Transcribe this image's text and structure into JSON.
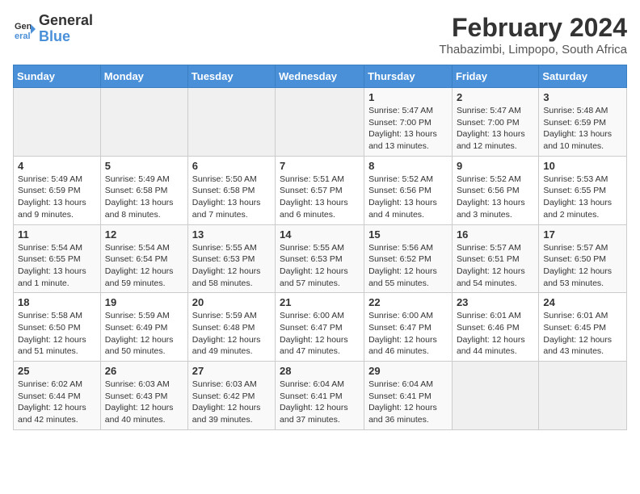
{
  "logo": {
    "text_general": "General",
    "text_blue": "Blue"
  },
  "title": "February 2024",
  "subtitle": "Thabazimbi, Limpopo, South Africa",
  "days_of_week": [
    "Sunday",
    "Monday",
    "Tuesday",
    "Wednesday",
    "Thursday",
    "Friday",
    "Saturday"
  ],
  "weeks": [
    [
      {
        "day": "",
        "info": ""
      },
      {
        "day": "",
        "info": ""
      },
      {
        "day": "",
        "info": ""
      },
      {
        "day": "",
        "info": ""
      },
      {
        "day": "1",
        "info": "Sunrise: 5:47 AM\nSunset: 7:00 PM\nDaylight: 13 hours and 13 minutes."
      },
      {
        "day": "2",
        "info": "Sunrise: 5:47 AM\nSunset: 7:00 PM\nDaylight: 13 hours and 12 minutes."
      },
      {
        "day": "3",
        "info": "Sunrise: 5:48 AM\nSunset: 6:59 PM\nDaylight: 13 hours and 10 minutes."
      }
    ],
    [
      {
        "day": "4",
        "info": "Sunrise: 5:49 AM\nSunset: 6:59 PM\nDaylight: 13 hours and 9 minutes."
      },
      {
        "day": "5",
        "info": "Sunrise: 5:49 AM\nSunset: 6:58 PM\nDaylight: 13 hours and 8 minutes."
      },
      {
        "day": "6",
        "info": "Sunrise: 5:50 AM\nSunset: 6:58 PM\nDaylight: 13 hours and 7 minutes."
      },
      {
        "day": "7",
        "info": "Sunrise: 5:51 AM\nSunset: 6:57 PM\nDaylight: 13 hours and 6 minutes."
      },
      {
        "day": "8",
        "info": "Sunrise: 5:52 AM\nSunset: 6:56 PM\nDaylight: 13 hours and 4 minutes."
      },
      {
        "day": "9",
        "info": "Sunrise: 5:52 AM\nSunset: 6:56 PM\nDaylight: 13 hours and 3 minutes."
      },
      {
        "day": "10",
        "info": "Sunrise: 5:53 AM\nSunset: 6:55 PM\nDaylight: 13 hours and 2 minutes."
      }
    ],
    [
      {
        "day": "11",
        "info": "Sunrise: 5:54 AM\nSunset: 6:55 PM\nDaylight: 13 hours and 1 minute."
      },
      {
        "day": "12",
        "info": "Sunrise: 5:54 AM\nSunset: 6:54 PM\nDaylight: 12 hours and 59 minutes."
      },
      {
        "day": "13",
        "info": "Sunrise: 5:55 AM\nSunset: 6:53 PM\nDaylight: 12 hours and 58 minutes."
      },
      {
        "day": "14",
        "info": "Sunrise: 5:55 AM\nSunset: 6:53 PM\nDaylight: 12 hours and 57 minutes."
      },
      {
        "day": "15",
        "info": "Sunrise: 5:56 AM\nSunset: 6:52 PM\nDaylight: 12 hours and 55 minutes."
      },
      {
        "day": "16",
        "info": "Sunrise: 5:57 AM\nSunset: 6:51 PM\nDaylight: 12 hours and 54 minutes."
      },
      {
        "day": "17",
        "info": "Sunrise: 5:57 AM\nSunset: 6:50 PM\nDaylight: 12 hours and 53 minutes."
      }
    ],
    [
      {
        "day": "18",
        "info": "Sunrise: 5:58 AM\nSunset: 6:50 PM\nDaylight: 12 hours and 51 minutes."
      },
      {
        "day": "19",
        "info": "Sunrise: 5:59 AM\nSunset: 6:49 PM\nDaylight: 12 hours and 50 minutes."
      },
      {
        "day": "20",
        "info": "Sunrise: 5:59 AM\nSunset: 6:48 PM\nDaylight: 12 hours and 49 minutes."
      },
      {
        "day": "21",
        "info": "Sunrise: 6:00 AM\nSunset: 6:47 PM\nDaylight: 12 hours and 47 minutes."
      },
      {
        "day": "22",
        "info": "Sunrise: 6:00 AM\nSunset: 6:47 PM\nDaylight: 12 hours and 46 minutes."
      },
      {
        "day": "23",
        "info": "Sunrise: 6:01 AM\nSunset: 6:46 PM\nDaylight: 12 hours and 44 minutes."
      },
      {
        "day": "24",
        "info": "Sunrise: 6:01 AM\nSunset: 6:45 PM\nDaylight: 12 hours and 43 minutes."
      }
    ],
    [
      {
        "day": "25",
        "info": "Sunrise: 6:02 AM\nSunset: 6:44 PM\nDaylight: 12 hours and 42 minutes."
      },
      {
        "day": "26",
        "info": "Sunrise: 6:03 AM\nSunset: 6:43 PM\nDaylight: 12 hours and 40 minutes."
      },
      {
        "day": "27",
        "info": "Sunrise: 6:03 AM\nSunset: 6:42 PM\nDaylight: 12 hours and 39 minutes."
      },
      {
        "day": "28",
        "info": "Sunrise: 6:04 AM\nSunset: 6:41 PM\nDaylight: 12 hours and 37 minutes."
      },
      {
        "day": "29",
        "info": "Sunrise: 6:04 AM\nSunset: 6:41 PM\nDaylight: 12 hours and 36 minutes."
      },
      {
        "day": "",
        "info": ""
      },
      {
        "day": "",
        "info": ""
      }
    ]
  ]
}
